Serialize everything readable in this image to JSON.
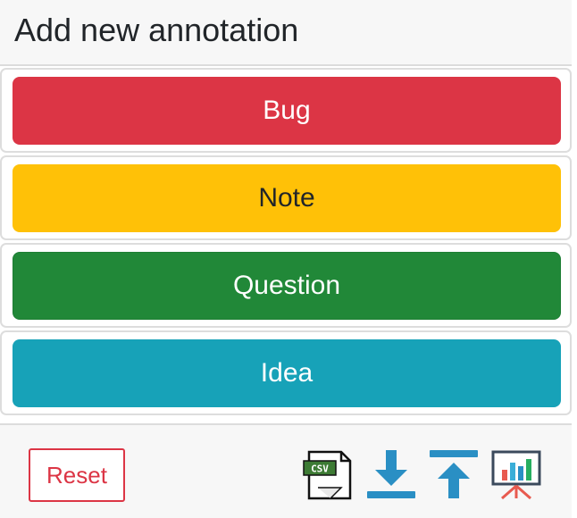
{
  "header": {
    "title": "Add new annotation"
  },
  "annotations": [
    {
      "label": "Bug",
      "color": "#dc3545"
    },
    {
      "label": "Note",
      "color": "#ffc107"
    },
    {
      "label": "Question",
      "color": "#218838"
    },
    {
      "label": "Idea",
      "color": "#17a2b8"
    }
  ],
  "footer": {
    "reset_label": "Reset",
    "csv_badge": "CSV",
    "icons": [
      "csv-file-icon",
      "download-icon",
      "upload-icon",
      "presentation-chart-icon"
    ],
    "icon_color": "#2a8fc4"
  }
}
